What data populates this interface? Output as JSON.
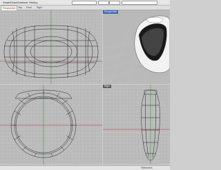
{
  "menu": {
    "items": [
      "SmartClose",
      "Sunbeat",
      "History"
    ]
  },
  "tabs": [
    "Perspective",
    "Top",
    "Front",
    "Right"
  ],
  "viewports": {
    "top": "",
    "perspective": "Perspective",
    "front": "",
    "right": "Right"
  },
  "status": {
    "text": "Millimeters"
  },
  "colors": {
    "grid": "#c6c6c6",
    "accent": "#3b65b5"
  }
}
